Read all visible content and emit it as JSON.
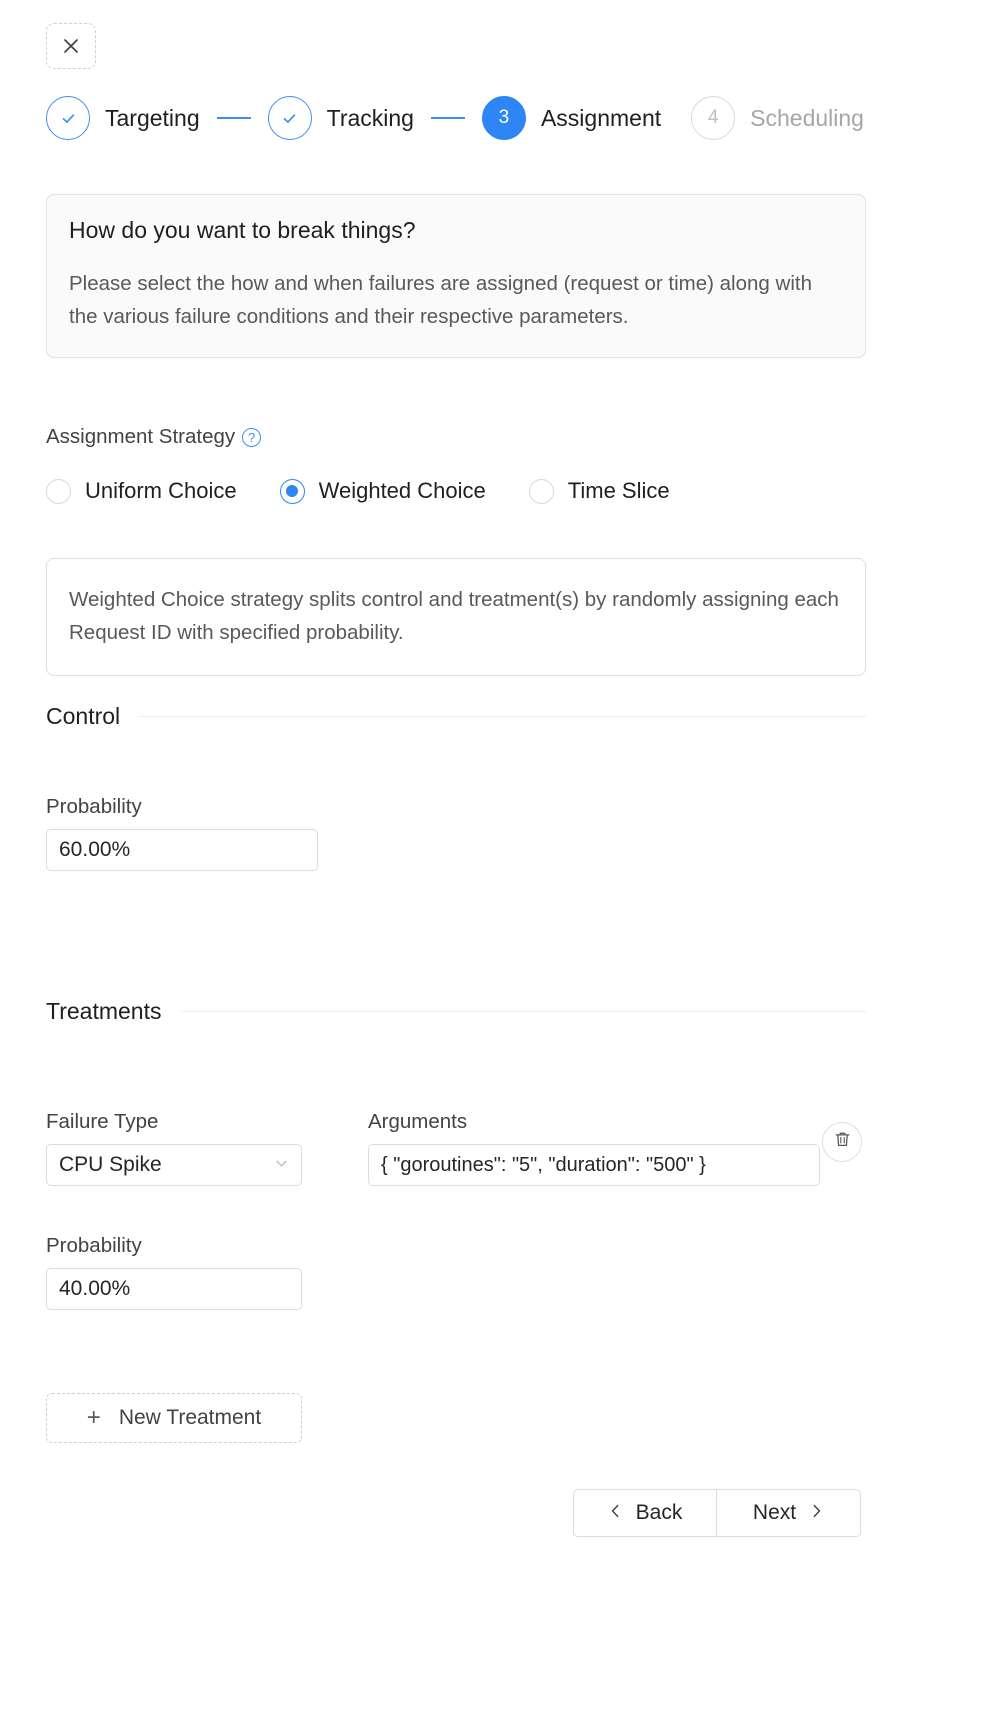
{
  "close_button": {
    "icon": "close-icon",
    "label": ""
  },
  "stepper": {
    "steps": [
      {
        "marker": "✓",
        "label": "Targeting",
        "state": "done"
      },
      {
        "marker": "✓",
        "label": "Tracking",
        "state": "done"
      },
      {
        "marker": "3",
        "label": "Assignment",
        "state": "active"
      },
      {
        "marker": "4",
        "label": "Scheduling",
        "state": "todo"
      }
    ]
  },
  "alert": {
    "title": "How do you want to break things?",
    "description": "Please select the how and when failures are assigned (request or time) along with the various failure conditions and their respective parameters."
  },
  "strategy": {
    "label": "Assignment Strategy",
    "help_icon": "?",
    "options": [
      {
        "label": "Uniform Choice",
        "selected": false
      },
      {
        "label": "Weighted Choice",
        "selected": true
      },
      {
        "label": "Time Slice",
        "selected": false
      }
    ],
    "description": "Weighted Choice strategy splits control and treatment(s) by randomly assigning each Request ID with specified probability."
  },
  "control": {
    "section_title": "Control",
    "probability_label": "Probability",
    "probability_value": "60.00%",
    "probability_placeholder": "Probability"
  },
  "treatments": {
    "section_title": "Treatments",
    "rows": [
      {
        "failure_type_label": "Failure Type",
        "failure_type_value": "CPU Spike",
        "arguments_label": "Arguments",
        "arguments_value": "{ \"goroutines\": \"5\", \"duration\": \"500\" }",
        "arguments_placeholder": "Arguments",
        "probability_label": "Probability",
        "probability_value": "40.00%",
        "probability_placeholder": "Probability",
        "delete_icon": "trash-icon"
      }
    ],
    "new_treatment_label": "New Treatment",
    "new_treatment_icon": "plus-icon"
  },
  "footer": {
    "back_label": "Back",
    "next_label": "Next",
    "back_icon": "chevron-left-icon",
    "next_icon": "chevron-right-icon"
  },
  "colors": {
    "accent": "#2d86f4",
    "accent_light": "#3d8ef5",
    "text": "#1f1f1f",
    "muted": "#a6a6a6",
    "border": "#dcdcdc"
  }
}
